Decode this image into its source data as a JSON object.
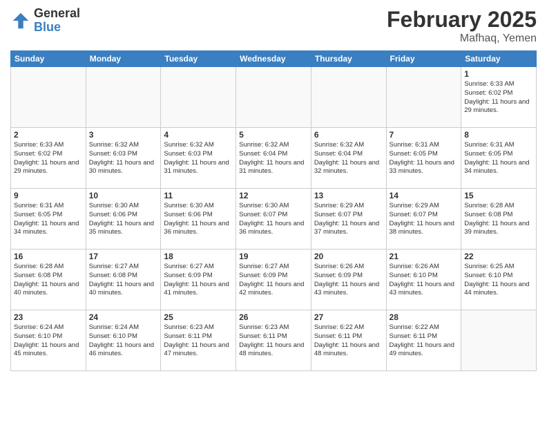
{
  "header": {
    "logo_general": "General",
    "logo_blue": "Blue",
    "month_year": "February 2025",
    "location": "Mafhaq, Yemen"
  },
  "weekdays": [
    "Sunday",
    "Monday",
    "Tuesday",
    "Wednesday",
    "Thursday",
    "Friday",
    "Saturday"
  ],
  "weeks": [
    [
      {
        "day": "",
        "info": ""
      },
      {
        "day": "",
        "info": ""
      },
      {
        "day": "",
        "info": ""
      },
      {
        "day": "",
        "info": ""
      },
      {
        "day": "",
        "info": ""
      },
      {
        "day": "",
        "info": ""
      },
      {
        "day": "1",
        "info": "Sunrise: 6:33 AM\nSunset: 6:02 PM\nDaylight: 11 hours\nand 29 minutes."
      }
    ],
    [
      {
        "day": "2",
        "info": "Sunrise: 6:33 AM\nSunset: 6:02 PM\nDaylight: 11 hours\nand 29 minutes."
      },
      {
        "day": "3",
        "info": "Sunrise: 6:32 AM\nSunset: 6:03 PM\nDaylight: 11 hours\nand 30 minutes."
      },
      {
        "day": "4",
        "info": "Sunrise: 6:32 AM\nSunset: 6:03 PM\nDaylight: 11 hours\nand 31 minutes."
      },
      {
        "day": "5",
        "info": "Sunrise: 6:32 AM\nSunset: 6:04 PM\nDaylight: 11 hours\nand 31 minutes."
      },
      {
        "day": "6",
        "info": "Sunrise: 6:32 AM\nSunset: 6:04 PM\nDaylight: 11 hours\nand 32 minutes."
      },
      {
        "day": "7",
        "info": "Sunrise: 6:31 AM\nSunset: 6:05 PM\nDaylight: 11 hours\nand 33 minutes."
      },
      {
        "day": "8",
        "info": "Sunrise: 6:31 AM\nSunset: 6:05 PM\nDaylight: 11 hours\nand 34 minutes."
      }
    ],
    [
      {
        "day": "9",
        "info": "Sunrise: 6:31 AM\nSunset: 6:05 PM\nDaylight: 11 hours\nand 34 minutes."
      },
      {
        "day": "10",
        "info": "Sunrise: 6:30 AM\nSunset: 6:06 PM\nDaylight: 11 hours\nand 35 minutes."
      },
      {
        "day": "11",
        "info": "Sunrise: 6:30 AM\nSunset: 6:06 PM\nDaylight: 11 hours\nand 36 minutes."
      },
      {
        "day": "12",
        "info": "Sunrise: 6:30 AM\nSunset: 6:07 PM\nDaylight: 11 hours\nand 36 minutes."
      },
      {
        "day": "13",
        "info": "Sunrise: 6:29 AM\nSunset: 6:07 PM\nDaylight: 11 hours\nand 37 minutes."
      },
      {
        "day": "14",
        "info": "Sunrise: 6:29 AM\nSunset: 6:07 PM\nDaylight: 11 hours\nand 38 minutes."
      },
      {
        "day": "15",
        "info": "Sunrise: 6:28 AM\nSunset: 6:08 PM\nDaylight: 11 hours\nand 39 minutes."
      }
    ],
    [
      {
        "day": "16",
        "info": "Sunrise: 6:28 AM\nSunset: 6:08 PM\nDaylight: 11 hours\nand 40 minutes."
      },
      {
        "day": "17",
        "info": "Sunrise: 6:27 AM\nSunset: 6:08 PM\nDaylight: 11 hours\nand 40 minutes."
      },
      {
        "day": "18",
        "info": "Sunrise: 6:27 AM\nSunset: 6:09 PM\nDaylight: 11 hours\nand 41 minutes."
      },
      {
        "day": "19",
        "info": "Sunrise: 6:27 AM\nSunset: 6:09 PM\nDaylight: 11 hours\nand 42 minutes."
      },
      {
        "day": "20",
        "info": "Sunrise: 6:26 AM\nSunset: 6:09 PM\nDaylight: 11 hours\nand 43 minutes."
      },
      {
        "day": "21",
        "info": "Sunrise: 6:26 AM\nSunset: 6:10 PM\nDaylight: 11 hours\nand 43 minutes."
      },
      {
        "day": "22",
        "info": "Sunrise: 6:25 AM\nSunset: 6:10 PM\nDaylight: 11 hours\nand 44 minutes."
      }
    ],
    [
      {
        "day": "23",
        "info": "Sunrise: 6:24 AM\nSunset: 6:10 PM\nDaylight: 11 hours\nand 45 minutes."
      },
      {
        "day": "24",
        "info": "Sunrise: 6:24 AM\nSunset: 6:10 PM\nDaylight: 11 hours\nand 46 minutes."
      },
      {
        "day": "25",
        "info": "Sunrise: 6:23 AM\nSunset: 6:11 PM\nDaylight: 11 hours\nand 47 minutes."
      },
      {
        "day": "26",
        "info": "Sunrise: 6:23 AM\nSunset: 6:11 PM\nDaylight: 11 hours\nand 48 minutes."
      },
      {
        "day": "27",
        "info": "Sunrise: 6:22 AM\nSunset: 6:11 PM\nDaylight: 11 hours\nand 48 minutes."
      },
      {
        "day": "28",
        "info": "Sunrise: 6:22 AM\nSunset: 6:11 PM\nDaylight: 11 hours\nand 49 minutes."
      },
      {
        "day": "",
        "info": ""
      }
    ]
  ]
}
